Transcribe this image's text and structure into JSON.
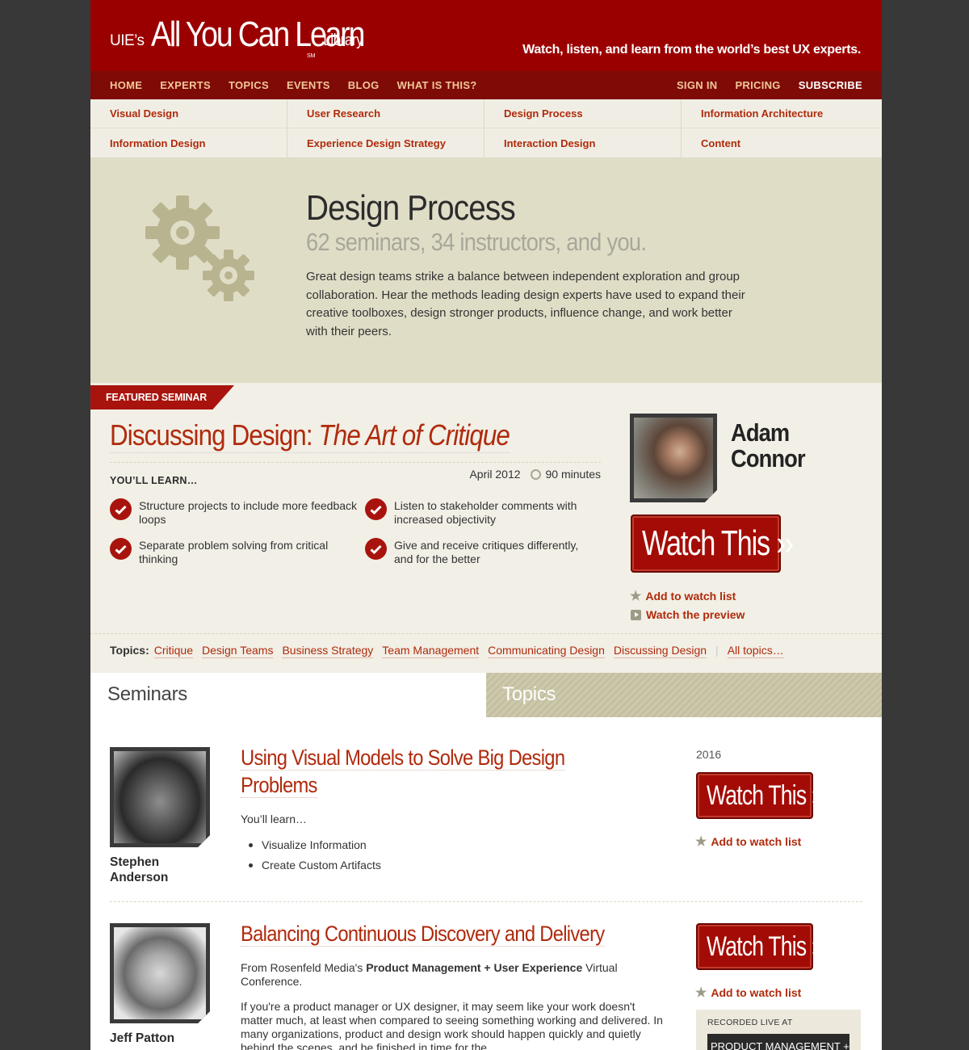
{
  "header": {
    "logo_pre": "UIE’s",
    "logo_main": "All You Can Learn",
    "logo_sm": "SM",
    "logo_post": "Library",
    "tagline": "Watch, listen, and learn from the world’s best UX experts."
  },
  "nav": {
    "left": [
      "HOME",
      "EXPERTS",
      "TOPICS",
      "EVENTS",
      "BLOG",
      "WHAT IS THIS?"
    ],
    "sign_in": "SIGN IN",
    "pricing": "PRICING",
    "subscribe": "SUBSCRIBE"
  },
  "topic_grid": [
    "Visual Design",
    "User Research",
    "Design Process",
    "Information Architecture",
    "Information Design",
    "Experience Design Strategy",
    "Interaction Design",
    "Content"
  ],
  "hero": {
    "title": "Design Process",
    "subtitle": "62 seminars, 34 instructors, and you.",
    "description": "Great design teams strike a balance between independent exploration and group collaboration. Hear the methods leading design experts have used to expand their creative toolboxes, design stronger products, influence change, and work better with their peers."
  },
  "featured": {
    "ribbon": "FEATURED SEMINAR",
    "title_plain": "Discussing Design:",
    "title_italic": "The Art of Critique",
    "date": "April 2012",
    "duration": "90 minutes",
    "learn_label": "YOU’LL LEARN…",
    "learn_items": [
      "Structure projects to include more feedback loops",
      "Listen to stakeholder comments with increased objectivity",
      "Separate problem solving from critical thinking",
      "Give and receive critiques differently, and for the better"
    ],
    "author_first": "Adam",
    "author_last": "Connor",
    "watch_label": "Watch This ››",
    "add_watchlist": "Add to watch list",
    "watch_preview": "Watch the preview",
    "topics_label": "Topics:",
    "topics": [
      "Critique",
      "Design Teams",
      "Business Strategy",
      "Team Management",
      "Communicating Design",
      "Discussing Design"
    ],
    "all_topics": "All topics…"
  },
  "tabs": {
    "seminars": "Seminars",
    "topics": "Topics"
  },
  "seminars": [
    {
      "author": "Stephen Anderson",
      "title": "Using Visual Models to Solve Big Design Problems",
      "year": "2016",
      "intro": "You’ll learn…",
      "bullets": [
        "Visualize Information",
        "Create Custom Artifacts"
      ],
      "watch_label": "Watch This ››",
      "add_watchlist": "Add to watch list"
    },
    {
      "author": "Jeff Patton",
      "title": "Balancing Continuous Discovery and Delivery",
      "from_pre": "From Rosenfeld Media's ",
      "from_bold": "Product Management + User Experience",
      "from_post": " Virtual Conference.",
      "body": "If you're a product manager or UX designer, it may seem like your work doesn't matter much, at least when compared to seeing something working and delivered. In many organizations, product and design work should happen quickly and quietly behind the scenes, and be finished in time for the",
      "watch_label": "Watch This ››",
      "add_watchlist": "Add to watch list",
      "recorded_label": "RECORDED LIVE AT",
      "recorded_book": "PRODUCT MANAGEMENT + USER"
    }
  ],
  "colors": {
    "brand_red": "#9b0000",
    "nav_red": "#7e0b06",
    "link_red": "#b02a0c",
    "hero_bg": "#e0ddc7",
    "cream": "#f1efe6"
  }
}
